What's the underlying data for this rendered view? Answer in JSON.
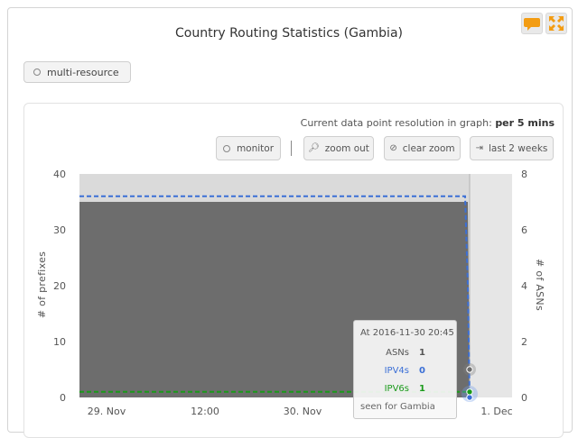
{
  "title": "Country Routing Statistics (Gambia)",
  "header_buttons": [
    {
      "name": "feedback",
      "icon": "speech-bubble-icon",
      "color": "#f39c12"
    },
    {
      "name": "fullscreen",
      "icon": "expand-icon",
      "color": "#f39c12"
    }
  ],
  "resource_chip": {
    "label": "multi-resource"
  },
  "resolution": {
    "label": "Current data point resolution in graph:",
    "value": "per 5 mins"
  },
  "toolbar": {
    "monitor": "monitor",
    "zoom_out": "zoom out",
    "clear_zoom": "clear zoom",
    "last_2_weeks": "last 2 weeks"
  },
  "axes": {
    "y_left_label": "# of prefixes",
    "y_right_label": "# of ASNs",
    "y_left_ticks": [
      "0",
      "10",
      "20",
      "30",
      "40"
    ],
    "y_right_ticks": [
      "0",
      "2",
      "4",
      "6",
      "8"
    ],
    "x_ticks": [
      "29. Nov",
      "12:00",
      "30. Nov",
      "1. Dec"
    ]
  },
  "chart_data": {
    "type": "area",
    "y_left_range": [
      0,
      40
    ],
    "y_right_range": [
      0,
      8
    ],
    "series": [
      {
        "name": "ASNs",
        "axis": "right",
        "style": "filled-area",
        "color": "#6d6d6d",
        "value_before_drop": 7,
        "value_at_tooltip": 1
      },
      {
        "name": "IPV4s",
        "axis": "left",
        "style": "dashed-line",
        "color": "#3b6fd6",
        "value_before_drop": 36,
        "value_at_tooltip": 0
      },
      {
        "name": "IPV6s",
        "axis": "left",
        "style": "dashed-line",
        "color": "#1a9a1a",
        "value_before_drop": 1,
        "value_at_tooltip": 1
      }
    ],
    "drop_time": "2016-11-30 20:45"
  },
  "tooltip": {
    "header": "At 2016-11-30 20:45",
    "rows": [
      {
        "label": "ASNs",
        "value": "1",
        "color": "#555555"
      },
      {
        "label": "IPV4s",
        "value": "0",
        "color": "#3b6fd6"
      },
      {
        "label": "IPV6s",
        "value": "1",
        "color": "#1a9a1a"
      }
    ],
    "footer": "seen for Gambia"
  }
}
